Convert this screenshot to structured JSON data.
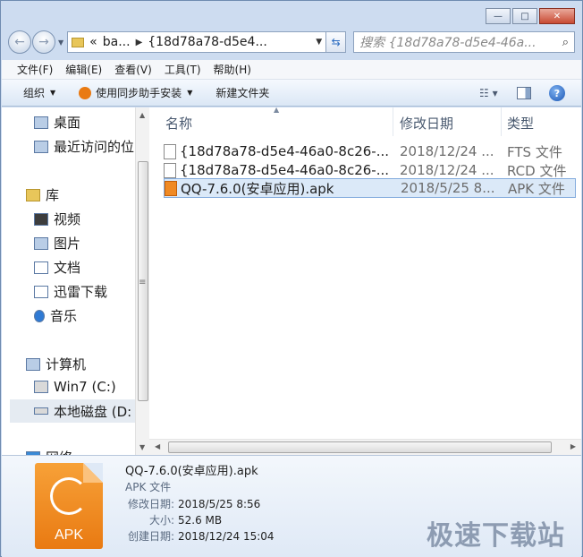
{
  "address": {
    "chevron": "«",
    "crumbs": [
      "ba...",
      "{18d78a78-d5e4..."
    ]
  },
  "search": {
    "placeholder": "搜索 {18d78a78-d5e4-46a..."
  },
  "menu": [
    "文件(F)",
    "编辑(E)",
    "查看(V)",
    "工具(T)",
    "帮助(H)"
  ],
  "commands": {
    "organize": "组织",
    "sync": "使用同步助手安装",
    "new_folder": "新建文件夹"
  },
  "nav": {
    "desktop": "桌面",
    "recent": "最近访问的位",
    "libraries": "库",
    "videos": "视频",
    "pictures": "图片",
    "documents": "文档",
    "thunder": "迅雷下载",
    "music": "音乐",
    "computer": "计算机",
    "drive_c": "Win7 (C:)",
    "drive_d": "本地磁盘 (D:",
    "network": "网络"
  },
  "columns": {
    "name": "名称",
    "date": "修改日期",
    "type": "类型"
  },
  "files": [
    {
      "name": "{18d78a78-d5e4-46a0-8c26-...",
      "date": "2018/12/24 ...",
      "type": "FTS 文件",
      "icon": "document-icon"
    },
    {
      "name": "{18d78a78-d5e4-46a0-8c26-...",
      "date": "2018/12/24 ...",
      "type": "RCD 文件",
      "icon": "document-icon"
    },
    {
      "name": "QQ-7.6.0(安卓应用).apk",
      "date": "2018/5/25 8...",
      "type": "APK 文件",
      "icon": "apk-icon"
    }
  ],
  "details": {
    "name": "QQ-7.6.0(安卓应用).apk",
    "type": "APK 文件",
    "icon_label": "APK",
    "modified_label": "修改日期:",
    "modified": "2018/5/25 8:56",
    "size_label": "大小:",
    "size": "52.6 MB",
    "created_label": "创建日期:",
    "created": "2018/12/24 15:04"
  },
  "watermark": "极速下载站",
  "colors": {
    "selection": "#dbe9f8",
    "accent": "#e97a12"
  }
}
